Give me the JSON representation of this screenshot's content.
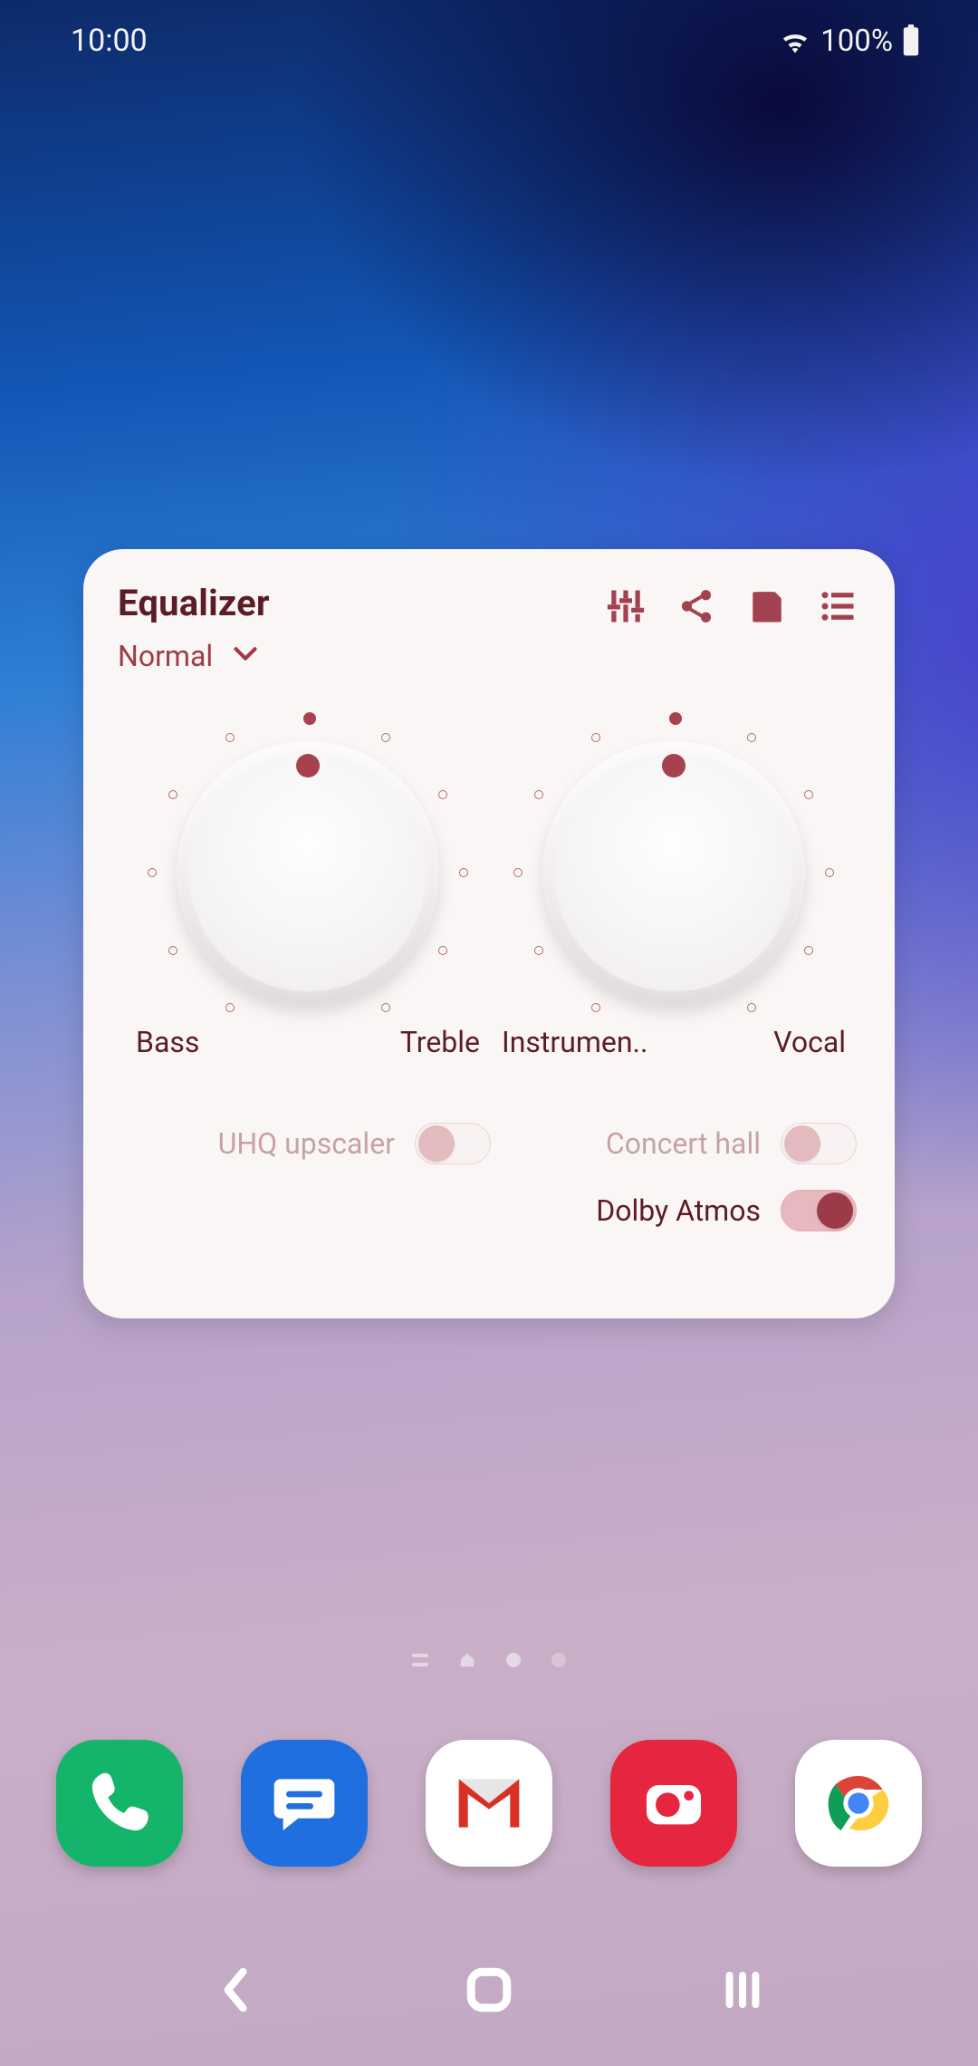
{
  "status_bar": {
    "time": "10:00",
    "battery_text": "100%"
  },
  "widget": {
    "title": "Equalizer",
    "preset": "Normal",
    "knobs": [
      {
        "left_label": "Bass",
        "right_label": "Treble"
      },
      {
        "left_label": "Instrumen..",
        "right_label": "Vocal"
      }
    ],
    "toggles": {
      "uhq": {
        "label": "UHQ upscaler",
        "on": false,
        "disabled": true
      },
      "concert": {
        "label": "Concert hall",
        "on": false,
        "disabled": true
      },
      "dolby": {
        "label": "Dolby Atmos",
        "on": true,
        "disabled": false
      }
    },
    "icons": [
      "sliders",
      "share",
      "save",
      "list"
    ]
  },
  "dock": {
    "apps": [
      "phone",
      "messages",
      "gmail",
      "camera",
      "chrome"
    ]
  }
}
